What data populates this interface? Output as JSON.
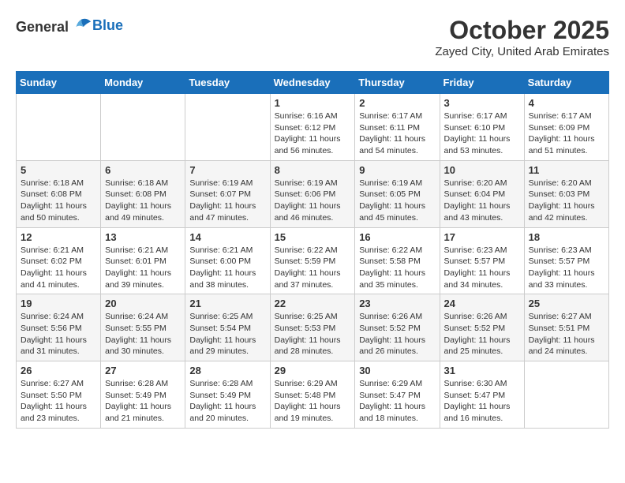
{
  "logo": {
    "general": "General",
    "blue": "Blue"
  },
  "header": {
    "month": "October 2025",
    "location": "Zayed City, United Arab Emirates"
  },
  "weekdays": [
    "Sunday",
    "Monday",
    "Tuesday",
    "Wednesday",
    "Thursday",
    "Friday",
    "Saturday"
  ],
  "weeks": [
    [
      {
        "day": "",
        "content": ""
      },
      {
        "day": "",
        "content": ""
      },
      {
        "day": "",
        "content": ""
      },
      {
        "day": "1",
        "content": "Sunrise: 6:16 AM\nSunset: 6:12 PM\nDaylight: 11 hours and 56 minutes."
      },
      {
        "day": "2",
        "content": "Sunrise: 6:17 AM\nSunset: 6:11 PM\nDaylight: 11 hours and 54 minutes."
      },
      {
        "day": "3",
        "content": "Sunrise: 6:17 AM\nSunset: 6:10 PM\nDaylight: 11 hours and 53 minutes."
      },
      {
        "day": "4",
        "content": "Sunrise: 6:17 AM\nSunset: 6:09 PM\nDaylight: 11 hours and 51 minutes."
      }
    ],
    [
      {
        "day": "5",
        "content": "Sunrise: 6:18 AM\nSunset: 6:08 PM\nDaylight: 11 hours and 50 minutes."
      },
      {
        "day": "6",
        "content": "Sunrise: 6:18 AM\nSunset: 6:08 PM\nDaylight: 11 hours and 49 minutes."
      },
      {
        "day": "7",
        "content": "Sunrise: 6:19 AM\nSunset: 6:07 PM\nDaylight: 11 hours and 47 minutes."
      },
      {
        "day": "8",
        "content": "Sunrise: 6:19 AM\nSunset: 6:06 PM\nDaylight: 11 hours and 46 minutes."
      },
      {
        "day": "9",
        "content": "Sunrise: 6:19 AM\nSunset: 6:05 PM\nDaylight: 11 hours and 45 minutes."
      },
      {
        "day": "10",
        "content": "Sunrise: 6:20 AM\nSunset: 6:04 PM\nDaylight: 11 hours and 43 minutes."
      },
      {
        "day": "11",
        "content": "Sunrise: 6:20 AM\nSunset: 6:03 PM\nDaylight: 11 hours and 42 minutes."
      }
    ],
    [
      {
        "day": "12",
        "content": "Sunrise: 6:21 AM\nSunset: 6:02 PM\nDaylight: 11 hours and 41 minutes."
      },
      {
        "day": "13",
        "content": "Sunrise: 6:21 AM\nSunset: 6:01 PM\nDaylight: 11 hours and 39 minutes."
      },
      {
        "day": "14",
        "content": "Sunrise: 6:21 AM\nSunset: 6:00 PM\nDaylight: 11 hours and 38 minutes."
      },
      {
        "day": "15",
        "content": "Sunrise: 6:22 AM\nSunset: 5:59 PM\nDaylight: 11 hours and 37 minutes."
      },
      {
        "day": "16",
        "content": "Sunrise: 6:22 AM\nSunset: 5:58 PM\nDaylight: 11 hours and 35 minutes."
      },
      {
        "day": "17",
        "content": "Sunrise: 6:23 AM\nSunset: 5:57 PM\nDaylight: 11 hours and 34 minutes."
      },
      {
        "day": "18",
        "content": "Sunrise: 6:23 AM\nSunset: 5:57 PM\nDaylight: 11 hours and 33 minutes."
      }
    ],
    [
      {
        "day": "19",
        "content": "Sunrise: 6:24 AM\nSunset: 5:56 PM\nDaylight: 11 hours and 31 minutes."
      },
      {
        "day": "20",
        "content": "Sunrise: 6:24 AM\nSunset: 5:55 PM\nDaylight: 11 hours and 30 minutes."
      },
      {
        "day": "21",
        "content": "Sunrise: 6:25 AM\nSunset: 5:54 PM\nDaylight: 11 hours and 29 minutes."
      },
      {
        "day": "22",
        "content": "Sunrise: 6:25 AM\nSunset: 5:53 PM\nDaylight: 11 hours and 28 minutes."
      },
      {
        "day": "23",
        "content": "Sunrise: 6:26 AM\nSunset: 5:52 PM\nDaylight: 11 hours and 26 minutes."
      },
      {
        "day": "24",
        "content": "Sunrise: 6:26 AM\nSunset: 5:52 PM\nDaylight: 11 hours and 25 minutes."
      },
      {
        "day": "25",
        "content": "Sunrise: 6:27 AM\nSunset: 5:51 PM\nDaylight: 11 hours and 24 minutes."
      }
    ],
    [
      {
        "day": "26",
        "content": "Sunrise: 6:27 AM\nSunset: 5:50 PM\nDaylight: 11 hours and 23 minutes."
      },
      {
        "day": "27",
        "content": "Sunrise: 6:28 AM\nSunset: 5:49 PM\nDaylight: 11 hours and 21 minutes."
      },
      {
        "day": "28",
        "content": "Sunrise: 6:28 AM\nSunset: 5:49 PM\nDaylight: 11 hours and 20 minutes."
      },
      {
        "day": "29",
        "content": "Sunrise: 6:29 AM\nSunset: 5:48 PM\nDaylight: 11 hours and 19 minutes."
      },
      {
        "day": "30",
        "content": "Sunrise: 6:29 AM\nSunset: 5:47 PM\nDaylight: 11 hours and 18 minutes."
      },
      {
        "day": "31",
        "content": "Sunrise: 6:30 AM\nSunset: 5:47 PM\nDaylight: 11 hours and 16 minutes."
      },
      {
        "day": "",
        "content": ""
      }
    ]
  ]
}
